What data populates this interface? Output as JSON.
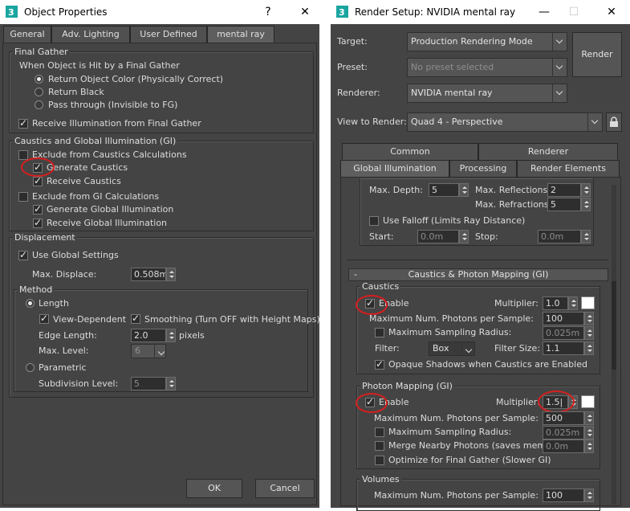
{
  "left_window": {
    "title": "Object Properties",
    "help": "?",
    "close": "✕",
    "tabs": [
      "General",
      "Adv. Lighting",
      "User Defined",
      "mental ray"
    ],
    "final_gather": {
      "title": "Final Gather",
      "when_hit": "When Object is Hit by a Final Gather",
      "radio": [
        "Return Object Color (Physically Correct)",
        "Return Black",
        "Pass through (Invisible to FG)"
      ],
      "receive_fg": "Receive Illumination from Final Gather"
    },
    "caustics_gi": {
      "title": "Caustics and Global Illumination (GI)",
      "exclude_caustics": "Exclude from Caustics Calculations",
      "generate_caustics": "Generate Caustics",
      "receive_caustics": "Receive Caustics",
      "exclude_gi": "Exclude from GI Calculations",
      "generate_gi": "Generate Global Illumination",
      "receive_gi": "Receive Global Illumination"
    },
    "displacement": {
      "title": "Displacement",
      "use_global": "Use Global Settings",
      "max_displace_label": "Max. Displace:",
      "max_displace_value": "0.508m",
      "method": {
        "title": "Method",
        "length": "Length",
        "view_dependent": "View-Dependent",
        "smoothing": "Smoothing (Turn OFF with Height Maps)",
        "edge_length_label": "Edge Length:",
        "edge_length_value": "2.0",
        "edge_length_unit": "pixels",
        "max_level_label": "Max. Level:",
        "max_level_value": "6",
        "parametric": "Parametric",
        "subdivision_label": "Subdivision Level:",
        "subdivision_value": "5"
      }
    },
    "ok": "OK",
    "cancel": "Cancel"
  },
  "right_window": {
    "title": "Render Setup: NVIDIA mental ray",
    "minimize": "—",
    "maximize": "☐",
    "close": "✕",
    "target_label": "Target:",
    "target_value": "Production Rendering Mode",
    "preset_label": "Preset:",
    "preset_value": "No preset selected",
    "renderer_label": "Renderer:",
    "renderer_value": "NVIDIA mental ray",
    "view_label": "View to Render:",
    "view_value": "Quad 4 - Perspective",
    "render_button": "Render",
    "lock_icon": "lock-icon",
    "tabs_row1": [
      "Common",
      "Renderer"
    ],
    "tabs_row2": [
      "Global Illumination",
      "Processing",
      "Render Elements"
    ],
    "trace": {
      "max_depth_label": "Max. Depth:",
      "max_depth_value": "5",
      "max_reflections_label": "Max. Reflections:",
      "max_reflections_value": "2",
      "max_refractions_label": "Max. Refractions:",
      "max_refractions_value": "5",
      "use_falloff": "Use Falloff (Limits Ray Distance)",
      "start_label": "Start:",
      "start_value": "0.0m",
      "stop_label": "Stop:",
      "stop_value": "0.0m"
    },
    "rollout": {
      "collapse": "-",
      "title": "Caustics & Photon Mapping (GI)"
    },
    "caustics": {
      "title": "Caustics",
      "enable": "Enable",
      "multiplier_label": "Multiplier:",
      "multiplier_value": "1.0",
      "max_photons_label": "Maximum Num. Photons per Sample:",
      "max_photons_value": "100",
      "max_radius": "Maximum Sampling Radius:",
      "max_radius_value": "0.025m",
      "filter_label": "Filter:",
      "filter_value": "Box",
      "filter_size_label": "Filter Size:",
      "filter_size_value": "1.1",
      "opaque_shadows": "Opaque Shadows when Caustics are Enabled"
    },
    "photon": {
      "title": "Photon Mapping (GI)",
      "enable": "Enable",
      "multiplier_label": "Multiplier:",
      "multiplier_value": "1.5|",
      "max_photons_label": "Maximum Num. Photons per Sample:",
      "max_photons_value": "500",
      "max_radius": "Maximum Sampling Radius:",
      "max_radius_value": "0.025m",
      "merge": "Merge Nearby Photons (saves memory):",
      "merge_value": "0.0m",
      "optimize": "Optimize for Final Gather (Slower GI)"
    },
    "volumes": {
      "title": "Volumes",
      "max_photons_label": "Maximum Num. Photons per Sample:",
      "max_photons_value": "100"
    }
  },
  "colors": {
    "highlight_ring": "#d81e1e",
    "panel": "#444444"
  }
}
